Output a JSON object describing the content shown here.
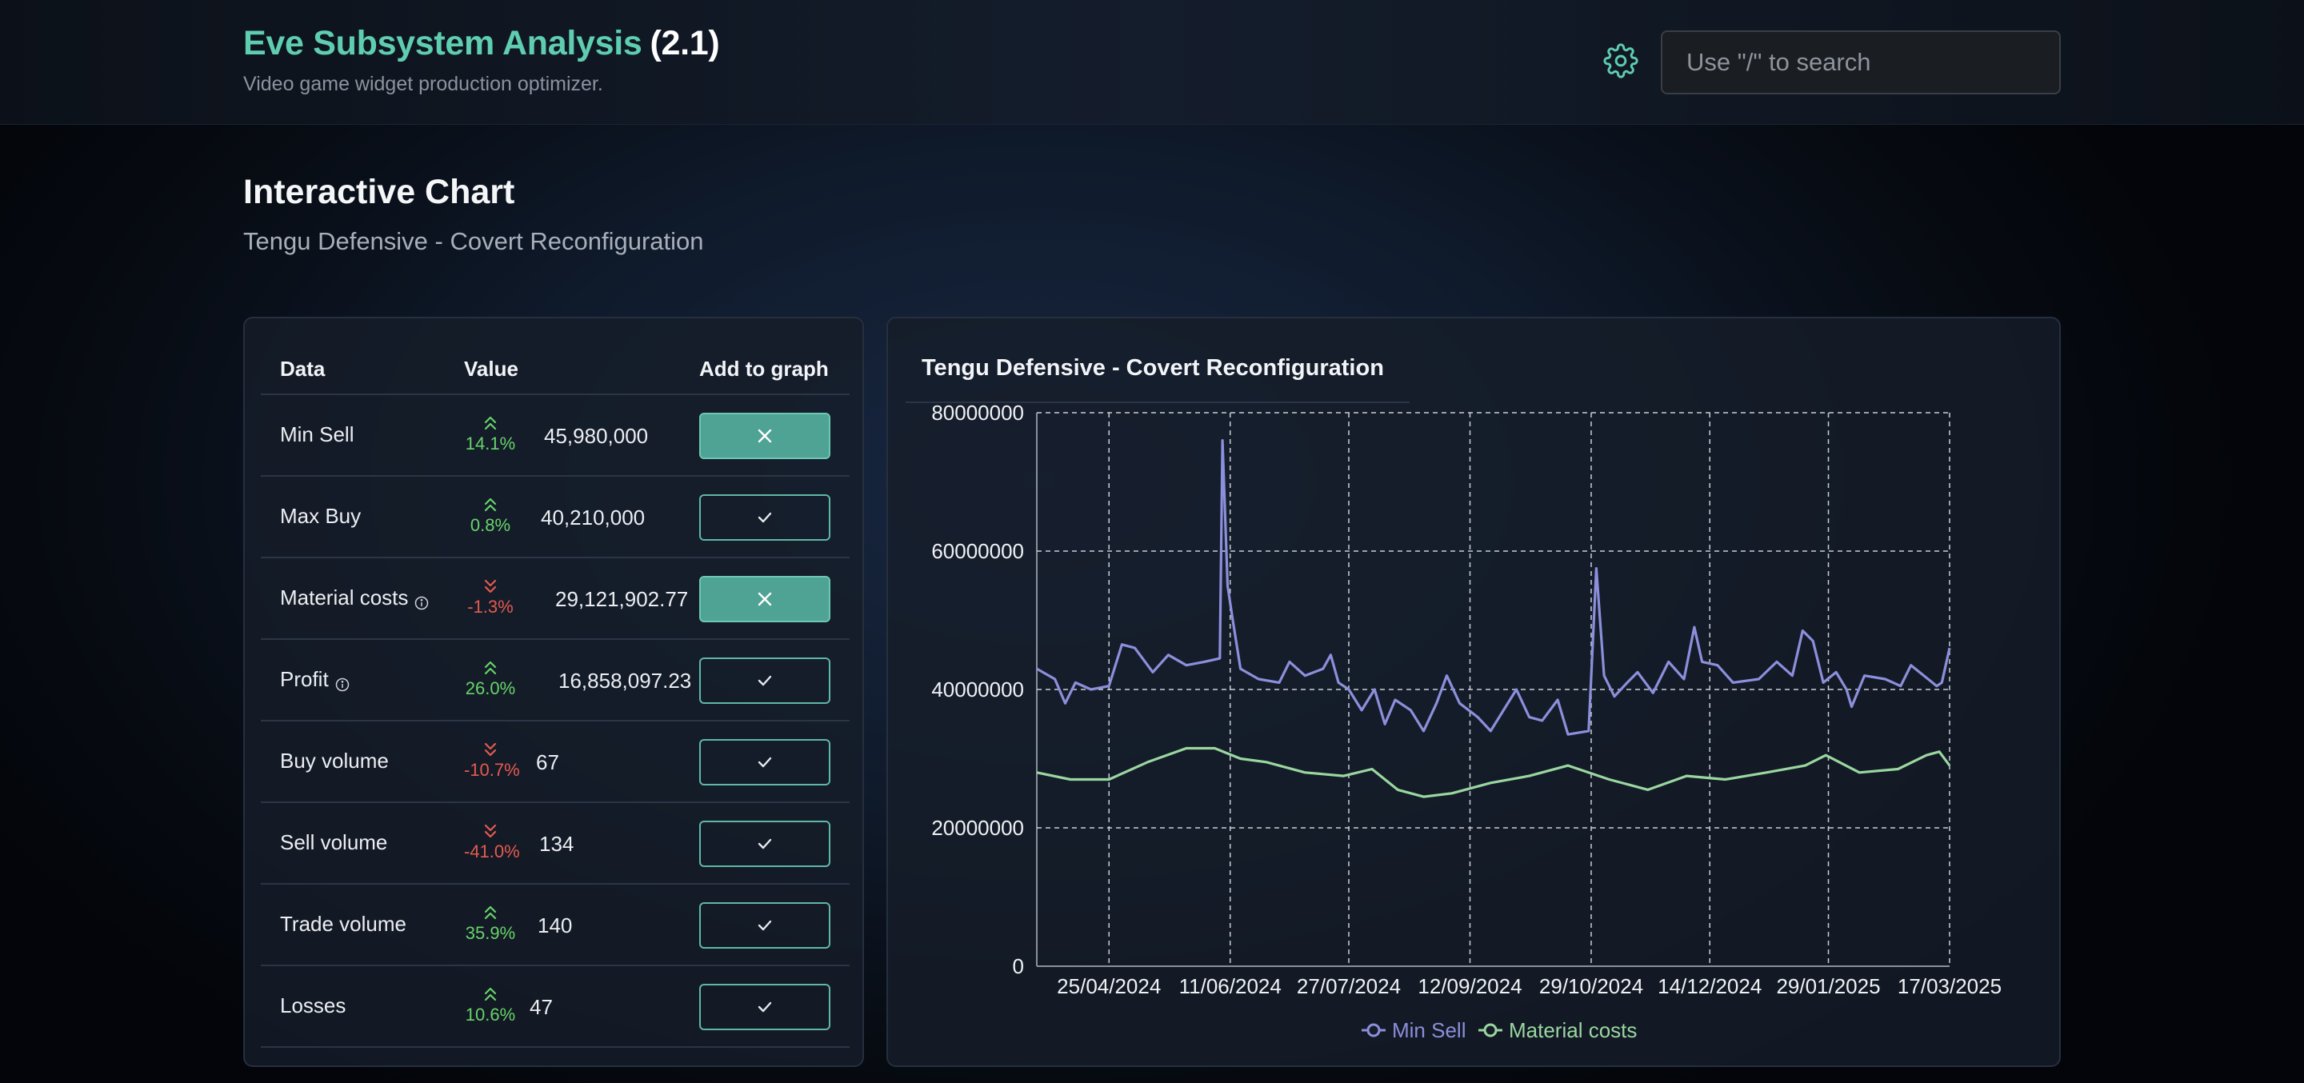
{
  "header": {
    "app_name": "Eve Subsystem Analysis",
    "version": "(2.1)",
    "tagline": "Video game widget production optimizer.",
    "settings_icon": "gear-icon",
    "search_placeholder": "Use \"/\" to search"
  },
  "page": {
    "title": "Interactive Chart",
    "subtitle": "Tengu Defensive - Covert Reconfiguration"
  },
  "table": {
    "headers": {
      "data": "Data",
      "value": "Value",
      "add": "Add to graph"
    },
    "rows": [
      {
        "name": "Min Sell",
        "info": false,
        "direction": "up",
        "change": "14.1%",
        "value": "45,980,000",
        "on_graph": true
      },
      {
        "name": "Max Buy",
        "info": false,
        "direction": "up",
        "change": "0.8%",
        "value": "40,210,000",
        "on_graph": false
      },
      {
        "name": "Material costs",
        "info": true,
        "direction": "down",
        "change": "-1.3%",
        "value": "29,121,902.77",
        "on_graph": true
      },
      {
        "name": "Profit",
        "info": true,
        "direction": "up",
        "change": "26.0%",
        "value": "16,858,097.23",
        "on_graph": false
      },
      {
        "name": "Buy volume",
        "info": false,
        "direction": "down",
        "change": "-10.7%",
        "value": "67",
        "on_graph": false
      },
      {
        "name": "Sell volume",
        "info": false,
        "direction": "down",
        "change": "-41.0%",
        "value": "134",
        "on_graph": false
      },
      {
        "name": "Trade volume",
        "info": false,
        "direction": "up",
        "change": "35.9%",
        "value": "140",
        "on_graph": false
      },
      {
        "name": "Losses",
        "info": false,
        "direction": "up",
        "change": "10.6%",
        "value": "47",
        "on_graph": false
      }
    ],
    "icons": {
      "remove": "close-icon",
      "add": "check-icon",
      "up": "double-chevron-up-icon",
      "down": "double-chevron-down-icon",
      "info": "info-icon"
    }
  },
  "colors": {
    "accent": "#5fcdb0",
    "up": "#68d36a",
    "down": "#e65a4f",
    "min_sell": "#8c8fdb",
    "material_costs": "#9ad7a0"
  },
  "chart_data": {
    "type": "line",
    "title": "Tengu Defensive - Covert Reconfiguration",
    "xlabel": "",
    "ylabel": "",
    "ylim": [
      0,
      80000000
    ],
    "yticks": [
      0,
      20000000,
      40000000,
      60000000,
      80000000
    ],
    "x_range": [
      "2024-03-28",
      "2025-03-17"
    ],
    "x_tick_labels": [
      "25/04/2024",
      "11/06/2024",
      "27/07/2024",
      "12/09/2024",
      "29/10/2024",
      "14/12/2024",
      "29/01/2025",
      "17/03/2025"
    ],
    "grid": true,
    "legend": "bottom",
    "series": [
      {
        "name": "Min Sell",
        "color": "#8c8fdb",
        "points": [
          [
            "2024-03-28",
            43000000
          ],
          [
            "2024-04-04",
            41500000
          ],
          [
            "2024-04-08",
            38000000
          ],
          [
            "2024-04-12",
            41000000
          ],
          [
            "2024-04-18",
            40000000
          ],
          [
            "2024-04-25",
            40500000
          ],
          [
            "2024-04-30",
            46500000
          ],
          [
            "2024-05-05",
            46000000
          ],
          [
            "2024-05-12",
            42500000
          ],
          [
            "2024-05-18",
            45000000
          ],
          [
            "2024-05-25",
            43500000
          ],
          [
            "2024-06-01",
            44000000
          ],
          [
            "2024-06-07",
            44500000
          ],
          [
            "2024-06-08",
            76000000
          ],
          [
            "2024-06-10",
            55000000
          ],
          [
            "2024-06-12",
            50000000
          ],
          [
            "2024-06-15",
            43000000
          ],
          [
            "2024-06-22",
            41500000
          ],
          [
            "2024-06-30",
            41000000
          ],
          [
            "2024-07-04",
            44000000
          ],
          [
            "2024-07-10",
            42000000
          ],
          [
            "2024-07-17",
            43000000
          ],
          [
            "2024-07-20",
            45000000
          ],
          [
            "2024-07-23",
            41000000
          ],
          [
            "2024-07-27",
            40000000
          ],
          [
            "2024-08-01",
            37000000
          ],
          [
            "2024-08-06",
            40000000
          ],
          [
            "2024-08-10",
            35000000
          ],
          [
            "2024-08-14",
            38500000
          ],
          [
            "2024-08-20",
            37000000
          ],
          [
            "2024-08-25",
            34000000
          ],
          [
            "2024-08-30",
            38000000
          ],
          [
            "2024-09-03",
            42000000
          ],
          [
            "2024-09-08",
            38000000
          ],
          [
            "2024-09-15",
            36000000
          ],
          [
            "2024-09-20",
            34000000
          ],
          [
            "2024-09-25",
            37000000
          ],
          [
            "2024-09-30",
            40000000
          ],
          [
            "2024-10-05",
            36000000
          ],
          [
            "2024-10-10",
            35500000
          ],
          [
            "2024-10-16",
            38500000
          ],
          [
            "2024-10-20",
            33500000
          ],
          [
            "2024-10-28",
            34000000
          ],
          [
            "2024-10-31",
            57500000
          ],
          [
            "2024-11-03",
            42000000
          ],
          [
            "2024-11-07",
            39000000
          ],
          [
            "2024-11-12",
            41000000
          ],
          [
            "2024-11-16",
            42500000
          ],
          [
            "2024-11-22",
            39500000
          ],
          [
            "2024-11-28",
            44000000
          ],
          [
            "2024-12-04",
            41500000
          ],
          [
            "2024-12-08",
            49000000
          ],
          [
            "2024-12-11",
            44000000
          ],
          [
            "2024-12-17",
            43500000
          ],
          [
            "2024-12-23",
            41000000
          ],
          [
            "2025-01-02",
            41500000
          ],
          [
            "2025-01-09",
            44000000
          ],
          [
            "2025-01-15",
            42000000
          ],
          [
            "2025-01-19",
            48500000
          ],
          [
            "2025-01-23",
            47000000
          ],
          [
            "2025-01-27",
            41000000
          ],
          [
            "2025-02-01",
            42500000
          ],
          [
            "2025-02-05",
            40000000
          ],
          [
            "2025-02-07",
            37500000
          ],
          [
            "2025-02-12",
            42000000
          ],
          [
            "2025-02-20",
            41500000
          ],
          [
            "2025-02-26",
            40500000
          ],
          [
            "2025-03-02",
            43500000
          ],
          [
            "2025-03-07",
            42000000
          ],
          [
            "2025-03-12",
            40500000
          ],
          [
            "2025-03-14",
            41000000
          ],
          [
            "2025-03-17",
            46000000
          ]
        ]
      },
      {
        "name": "Material costs",
        "color": "#9ad7a0",
        "points": [
          [
            "2024-03-28",
            28000000
          ],
          [
            "2024-04-10",
            27000000
          ],
          [
            "2024-04-25",
            27000000
          ],
          [
            "2024-05-10",
            29500000
          ],
          [
            "2024-05-25",
            31500000
          ],
          [
            "2024-06-05",
            31500000
          ],
          [
            "2024-06-15",
            30000000
          ],
          [
            "2024-06-25",
            29500000
          ],
          [
            "2024-07-10",
            28000000
          ],
          [
            "2024-07-25",
            27500000
          ],
          [
            "2024-08-05",
            28500000
          ],
          [
            "2024-08-15",
            25500000
          ],
          [
            "2024-08-25",
            24500000
          ],
          [
            "2024-09-05",
            25000000
          ],
          [
            "2024-09-20",
            26500000
          ],
          [
            "2024-10-05",
            27500000
          ],
          [
            "2024-10-20",
            29000000
          ],
          [
            "2024-11-05",
            27000000
          ],
          [
            "2024-11-20",
            25500000
          ],
          [
            "2024-12-05",
            27500000
          ],
          [
            "2024-12-20",
            27000000
          ],
          [
            "2025-01-05",
            28000000
          ],
          [
            "2025-01-20",
            29000000
          ],
          [
            "2025-01-28",
            30500000
          ],
          [
            "2025-02-10",
            28000000
          ],
          [
            "2025-02-25",
            28500000
          ],
          [
            "2025-03-08",
            30500000
          ],
          [
            "2025-03-13",
            31000000
          ],
          [
            "2025-03-17",
            29000000
          ]
        ]
      }
    ]
  }
}
